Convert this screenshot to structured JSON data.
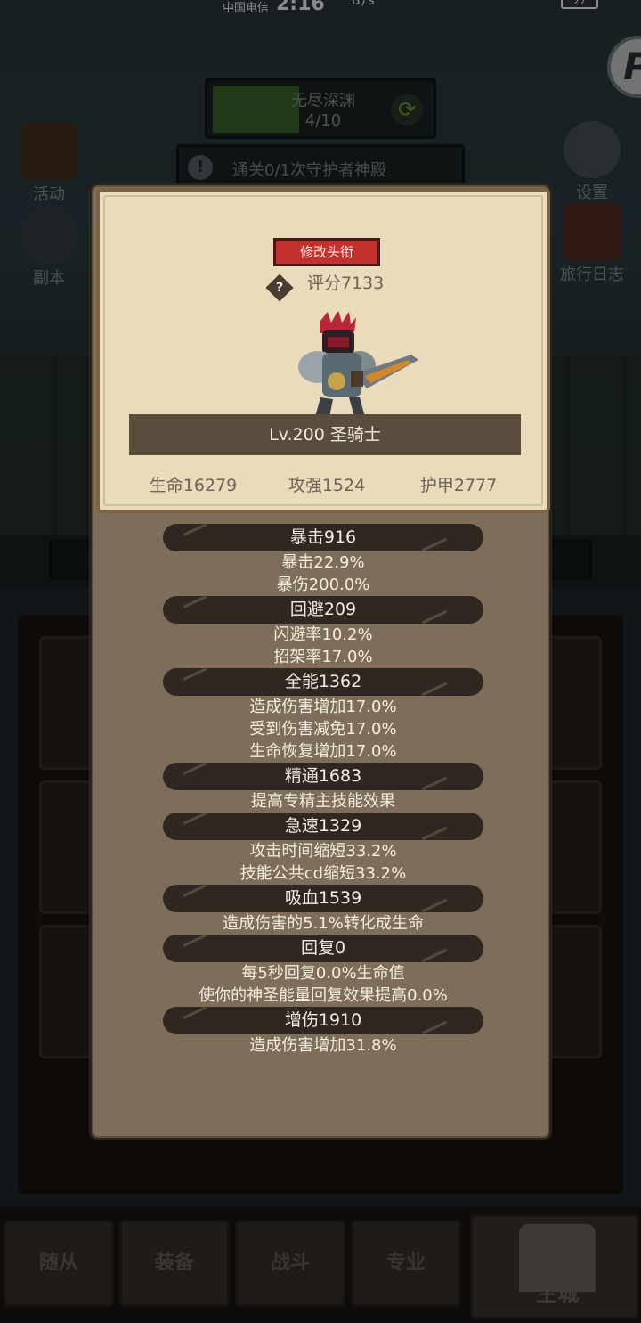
{
  "status_bar": {
    "carrier": "中国电信",
    "time": "2:16",
    "right": "B/s",
    "battery": "27"
  },
  "stage": {
    "name": "无尽深渊",
    "progress": "4/10",
    "fill_fraction": 0.4
  },
  "quest": {
    "text": "通关0/1次守护者神殿"
  },
  "side_buttons": {
    "activity": "活动",
    "dungeon": "副本",
    "settings": "设置",
    "travel_log": "旅行日志"
  },
  "bottom_nav": {
    "tabs": [
      "随从",
      "装备",
      "战斗",
      "专业"
    ],
    "main": "主城"
  },
  "modal": {
    "title_button": "修改头衔",
    "score": "评分7133",
    "level_class": "Lv.200 圣骑士",
    "attributes": {
      "hp": "生命16279",
      "attack": "攻强1524",
      "armor": "护甲2777"
    },
    "stats": [
      {
        "header": "暴击916",
        "lines": [
          "暴击22.9%",
          "暴伤200.0%"
        ]
      },
      {
        "header": "回避209",
        "lines": [
          "闪避率10.2%",
          "招架率17.0%"
        ]
      },
      {
        "header": "全能1362",
        "lines": [
          "造成伤害增加17.0%",
          "受到伤害减免17.0%",
          "生命恢复增加17.0%"
        ]
      },
      {
        "header": "精通1683",
        "lines": [
          "提高专精主技能效果"
        ]
      },
      {
        "header": "急速1329",
        "lines": [
          "攻击时间缩短33.2%",
          "技能公共cd缩短33.2%"
        ]
      },
      {
        "header": "吸血1539",
        "lines": [
          "造成伤害的5.1%转化成生命"
        ]
      },
      {
        "header": "回复0",
        "lines": [
          "每5秒回复0.0%生命值",
          "使你的神圣能量回复效果提高0.0%"
        ]
      },
      {
        "header": "增伤1910",
        "lines": [
          "造成伤害增加31.8%"
        ]
      }
    ]
  }
}
